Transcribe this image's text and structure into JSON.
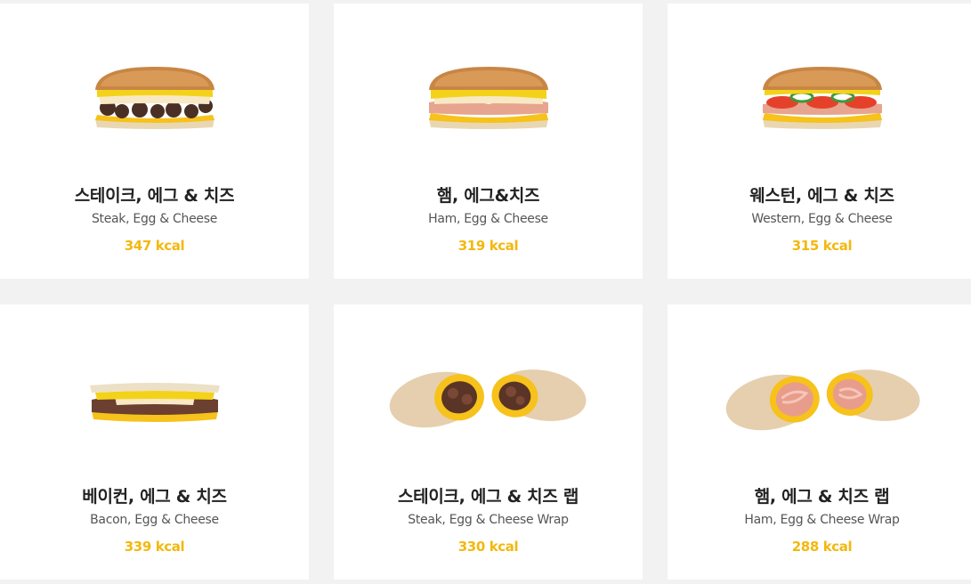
{
  "menu": {
    "items": [
      {
        "name_ko": "스테이크, 에그 & 치즈",
        "name_en": "Steak, Egg & Cheese",
        "kcal": "347 kcal",
        "image": "steak-egg-cheese-sandwich"
      },
      {
        "name_ko": "햄, 에그&치즈",
        "name_en": "Ham, Egg & Cheese",
        "kcal": "319 kcal",
        "image": "ham-egg-cheese-sandwich"
      },
      {
        "name_ko": "웨스턴, 에그 & 치즈",
        "name_en": "Western, Egg & Cheese",
        "kcal": "315 kcal",
        "image": "western-egg-cheese-sandwich"
      },
      {
        "name_ko": "베이컨, 에그 & 치즈",
        "name_en": "Bacon, Egg & Cheese",
        "kcal": "339 kcal",
        "image": "bacon-egg-cheese-sandwich"
      },
      {
        "name_ko": "스테이크, 에그 & 치즈 랩",
        "name_en": "Steak, Egg & Cheese Wrap",
        "kcal": "330 kcal",
        "image": "steak-egg-cheese-wrap"
      },
      {
        "name_ko": "햄, 에그 & 치즈 랩",
        "name_en": "Ham, Egg & Cheese Wrap",
        "kcal": "288 kcal",
        "image": "ham-egg-cheese-wrap"
      }
    ]
  },
  "colors": {
    "background": "#f2f2f2",
    "card": "#ffffff",
    "kcal": "#f3b80f",
    "title": "#222222",
    "subtitle": "#555555"
  }
}
